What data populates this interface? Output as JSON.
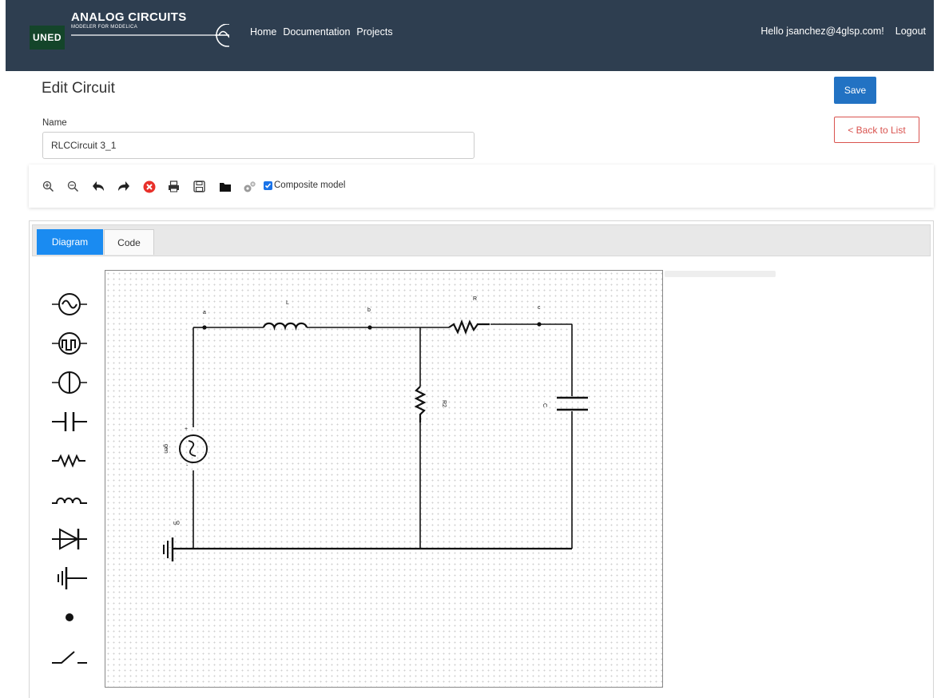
{
  "brand": {
    "badge": "UNED",
    "title": "ANALOG CIRCUITS",
    "subtitle": "MODELER FOR MODELICA"
  },
  "nav": {
    "links": [
      "Home",
      "Documentation",
      "Projects"
    ],
    "greeting": "Hello jsanchez@4glsp.com!",
    "logout": "Logout"
  },
  "page": {
    "title": "Edit Circuit",
    "save_label": "Save",
    "back_label": "< Back to List"
  },
  "form": {
    "name_label": "Name",
    "name_value": "RLCCircuit 3_1"
  },
  "toolbar": {
    "icons": [
      "zoom-in-icon",
      "zoom-out-icon",
      "undo-icon",
      "redo-icon",
      "delete-icon",
      "print-icon",
      "save-icon",
      "folder-icon",
      "settings-icon"
    ],
    "composite_label": "Composite model",
    "composite_checked": true
  },
  "tabs": {
    "diagram": "Diagram",
    "code": "Code",
    "active": "Diagram"
  },
  "palette": [
    "sine-voltage-source-icon",
    "pulse-voltage-source-icon",
    "current-source-icon",
    "capacitor-icon",
    "resistor-icon",
    "inductor-icon",
    "diode-icon",
    "ground-icon",
    "node-icon",
    "switch-icon"
  ],
  "diagram": {
    "labels": {
      "node_a": "a",
      "node_b": "b",
      "node_c": "c",
      "inductor": "L",
      "resistor": "R",
      "resistor2": "R2",
      "capacitor": "C",
      "source": "gen",
      "ground": "u0",
      "plus": "+",
      "minus": "-"
    }
  },
  "colors": {
    "navbar": "#2e3e50",
    "brand_badge": "#14452a",
    "primary": "#2272c3",
    "danger": "#d9534f",
    "tab_active": "#1a8bf1"
  }
}
